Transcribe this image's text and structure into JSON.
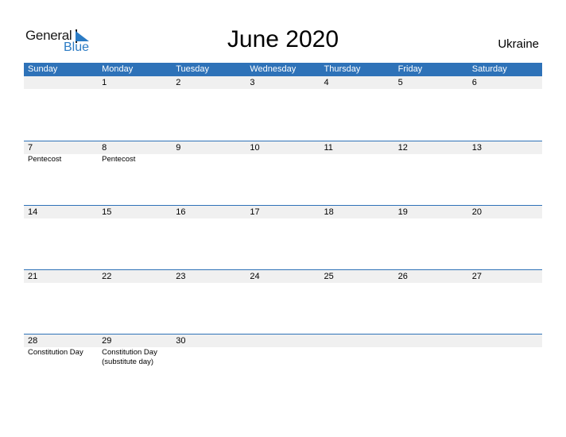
{
  "logo": {
    "line1": "General",
    "line2": "Blue"
  },
  "title": "June 2020",
  "country": "Ukraine",
  "weekdays": [
    "Sunday",
    "Monday",
    "Tuesday",
    "Wednesday",
    "Thursday",
    "Friday",
    "Saturday"
  ],
  "weeks": [
    {
      "days": [
        "",
        "1",
        "2",
        "3",
        "4",
        "5",
        "6"
      ],
      "events": [
        "",
        "",
        "",
        "",
        "",
        "",
        ""
      ]
    },
    {
      "days": [
        "7",
        "8",
        "9",
        "10",
        "11",
        "12",
        "13"
      ],
      "events": [
        "Pentecost",
        "Pentecost",
        "",
        "",
        "",
        "",
        ""
      ]
    },
    {
      "days": [
        "14",
        "15",
        "16",
        "17",
        "18",
        "19",
        "20"
      ],
      "events": [
        "",
        "",
        "",
        "",
        "",
        "",
        ""
      ]
    },
    {
      "days": [
        "21",
        "22",
        "23",
        "24",
        "25",
        "26",
        "27"
      ],
      "events": [
        "",
        "",
        "",
        "",
        "",
        "",
        ""
      ]
    },
    {
      "days": [
        "28",
        "29",
        "30",
        "",
        "",
        "",
        ""
      ],
      "events": [
        "Constitution Day",
        "Constitution Day (substitute day)",
        "",
        "",
        "",
        "",
        ""
      ]
    }
  ],
  "colors": {
    "accent": "#2e72b8",
    "band": "#f0f0f0",
    "logo_blue": "#2b7bc4"
  }
}
